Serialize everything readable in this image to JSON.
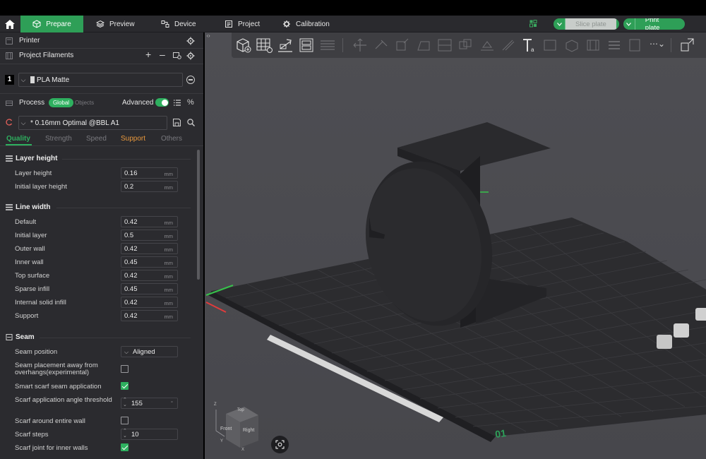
{
  "tabs": [
    {
      "label": "Prepare",
      "icon": "cube-icon"
    },
    {
      "label": "Preview",
      "icon": "layers-icon"
    },
    {
      "label": "Device",
      "icon": "device-icon"
    },
    {
      "label": "Project",
      "icon": "project-icon"
    },
    {
      "label": "Calibration",
      "icon": "calibration-icon"
    }
  ],
  "actions": {
    "slice": "Slice plate",
    "print": "Print plate"
  },
  "printer": {
    "label": "Printer"
  },
  "filaments": {
    "label": "Project Filaments",
    "slot": "1",
    "name": "PLA Matte"
  },
  "process": {
    "label": "Process",
    "global": "Global",
    "objects": "Objects",
    "advanced": "Advanced",
    "preset": "* 0.16mm Optimal @BBL A1"
  },
  "qtabs": [
    "Quality",
    "Strength",
    "Speed",
    "Support",
    "Others"
  ],
  "sections": {
    "layer_height": {
      "title": "Layer height",
      "params": [
        {
          "label": "Layer height",
          "value": "0.16",
          "unit": "mm"
        },
        {
          "label": "Initial layer height",
          "value": "0.2",
          "unit": "mm"
        }
      ]
    },
    "line_width": {
      "title": "Line width",
      "params": [
        {
          "label": "Default",
          "value": "0.42",
          "unit": "mm"
        },
        {
          "label": "Initial layer",
          "value": "0.5",
          "unit": "mm"
        },
        {
          "label": "Outer wall",
          "value": "0.42",
          "unit": "mm"
        },
        {
          "label": "Inner wall",
          "value": "0.45",
          "unit": "mm"
        },
        {
          "label": "Top surface",
          "value": "0.42",
          "unit": "mm"
        },
        {
          "label": "Sparse infill",
          "value": "0.45",
          "unit": "mm"
        },
        {
          "label": "Internal solid infill",
          "value": "0.42",
          "unit": "mm"
        },
        {
          "label": "Support",
          "value": "0.42",
          "unit": "mm"
        }
      ]
    },
    "seam": {
      "title": "Seam",
      "seam_position": {
        "label": "Seam position",
        "value": "Aligned"
      },
      "placement_away": {
        "label": "Seam placement away from overhangs(experimental)",
        "checked": false
      },
      "smart_scarf": {
        "label": "Smart scarf seam application",
        "checked": true
      },
      "scarf_angle": {
        "label": "Scarf application angle threshold",
        "value": "155",
        "unit": "°"
      },
      "scarf_around": {
        "label": "Scarf around entire wall",
        "checked": false
      },
      "scarf_steps": {
        "label": "Scarf steps",
        "value": "10"
      },
      "scarf_inner": {
        "label": "Scarf joint for inner walls",
        "checked": true
      }
    }
  },
  "viewcube": {
    "top": "Top",
    "front": "Front",
    "right": "Right",
    "axis_x": "X",
    "axis_y": "Y",
    "axis_z": "Z"
  },
  "bed": {
    "plate_number": "01"
  },
  "colors": {
    "accent": "#2eb05f",
    "support_tab": "#e8983c",
    "panel": "#2b2b2f",
    "viewport": "#4b4b50"
  }
}
